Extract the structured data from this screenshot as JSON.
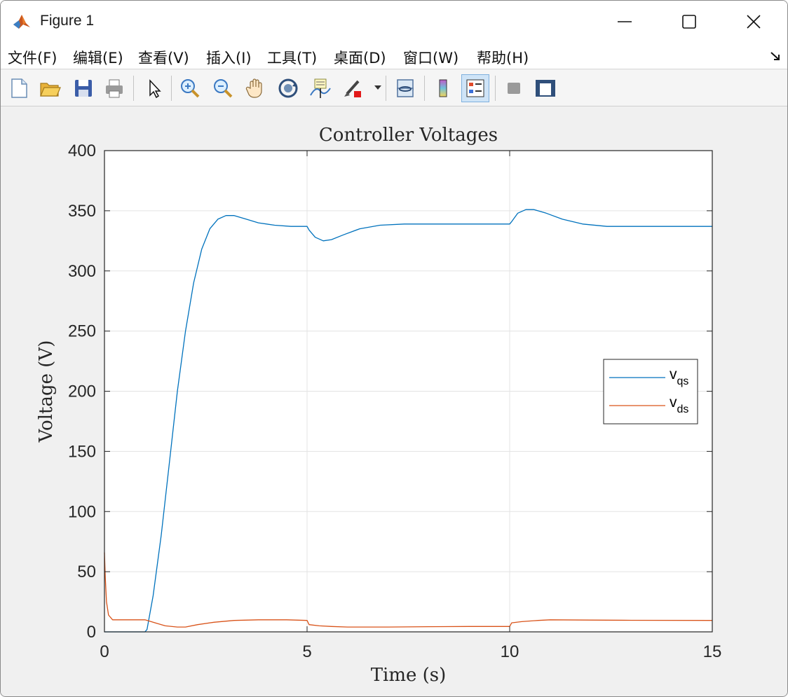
{
  "window": {
    "title": "Figure 1",
    "controls": {
      "minimize": "minimize-icon",
      "maximize": "maximize-icon",
      "close": "close-icon"
    }
  },
  "menubar": {
    "items": [
      {
        "label": "文件(F)"
      },
      {
        "label": "编辑(E)"
      },
      {
        "label": "查看(V)"
      },
      {
        "label": "插入(I)"
      },
      {
        "label": "工具(T)"
      },
      {
        "label": "桌面(D)"
      },
      {
        "label": "窗口(W)"
      },
      {
        "label": "帮助(H)"
      }
    ]
  },
  "toolbar": {
    "buttons": [
      {
        "icon": "new-figure-icon"
      },
      {
        "icon": "open-file-icon"
      },
      {
        "icon": "save-icon"
      },
      {
        "icon": "print-icon"
      },
      {
        "icon": "edit-plot-arrow-icon"
      },
      {
        "icon": "zoom-in-icon"
      },
      {
        "icon": "zoom-out-icon"
      },
      {
        "icon": "pan-hand-icon"
      },
      {
        "icon": "rotate-3d-icon"
      },
      {
        "icon": "data-cursor-icon"
      },
      {
        "icon": "brush-icon"
      },
      {
        "icon": "link-plot-icon"
      },
      {
        "icon": "colorbar-icon"
      },
      {
        "icon": "legend-icon",
        "active": true
      },
      {
        "icon": "hide-plot-tools-icon"
      },
      {
        "icon": "show-plot-tools-icon"
      }
    ]
  },
  "colors": {
    "vqs": "#0072bd",
    "vds": "#d95319",
    "grid": "#e3e3e3",
    "axes": "#262626"
  },
  "chart_data": {
    "type": "line",
    "title": "Controller Voltages",
    "xlabel": "Time (s)",
    "ylabel": "Voltage (V)",
    "xlim": [
      0,
      15
    ],
    "ylim": [
      0,
      400
    ],
    "xticks": [
      0,
      5,
      10,
      15
    ],
    "yticks": [
      0,
      50,
      100,
      150,
      200,
      250,
      300,
      350,
      400
    ],
    "grid": true,
    "legend_position": "right",
    "series": [
      {
        "name": "v_qs",
        "legend_main": "v",
        "legend_sub": "qs",
        "color": "#0072bd",
        "x": [
          0,
          0.5,
          1.0,
          1.05,
          1.2,
          1.4,
          1.6,
          1.8,
          2.0,
          2.2,
          2.4,
          2.6,
          2.8,
          3.0,
          3.2,
          3.5,
          3.8,
          4.2,
          4.6,
          5.0,
          5.05,
          5.2,
          5.4,
          5.6,
          5.9,
          6.3,
          6.8,
          7.4,
          8.0,
          9.0,
          10.0,
          10.05,
          10.2,
          10.4,
          10.6,
          10.9,
          11.3,
          11.8,
          12.4,
          13.0,
          14.0,
          15.0
        ],
        "y": [
          0,
          0,
          0,
          2,
          30,
          80,
          140,
          200,
          250,
          290,
          318,
          335,
          343,
          346,
          346,
          343,
          340,
          338,
          337,
          337,
          334,
          328,
          325,
          326,
          330,
          335,
          338,
          339,
          339,
          339,
          339,
          341,
          348,
          351,
          351,
          348,
          343,
          339,
          337,
          337,
          337,
          337
        ]
      },
      {
        "name": "v_ds",
        "legend_main": "v",
        "legend_sub": "ds",
        "color": "#d95319",
        "x": [
          0,
          0.02,
          0.05,
          0.1,
          0.2,
          0.5,
          1.0,
          1.2,
          1.5,
          1.8,
          2.0,
          2.3,
          2.7,
          3.2,
          3.8,
          4.5,
          5.0,
          5.05,
          5.3,
          5.6,
          6.0,
          7.0,
          8.0,
          9.0,
          10.0,
          10.05,
          10.3,
          10.7,
          11.0,
          12.0,
          13.0,
          15.0
        ],
        "y": [
          66,
          45,
          25,
          14,
          10,
          10,
          10,
          8,
          5,
          4,
          4,
          6,
          8,
          9.5,
          10,
          10,
          9.5,
          6,
          5,
          4.5,
          4,
          4,
          4.3,
          4.5,
          4.5,
          7.5,
          8.5,
          9.5,
          10,
          9.8,
          9.6,
          9.5
        ]
      }
    ]
  }
}
